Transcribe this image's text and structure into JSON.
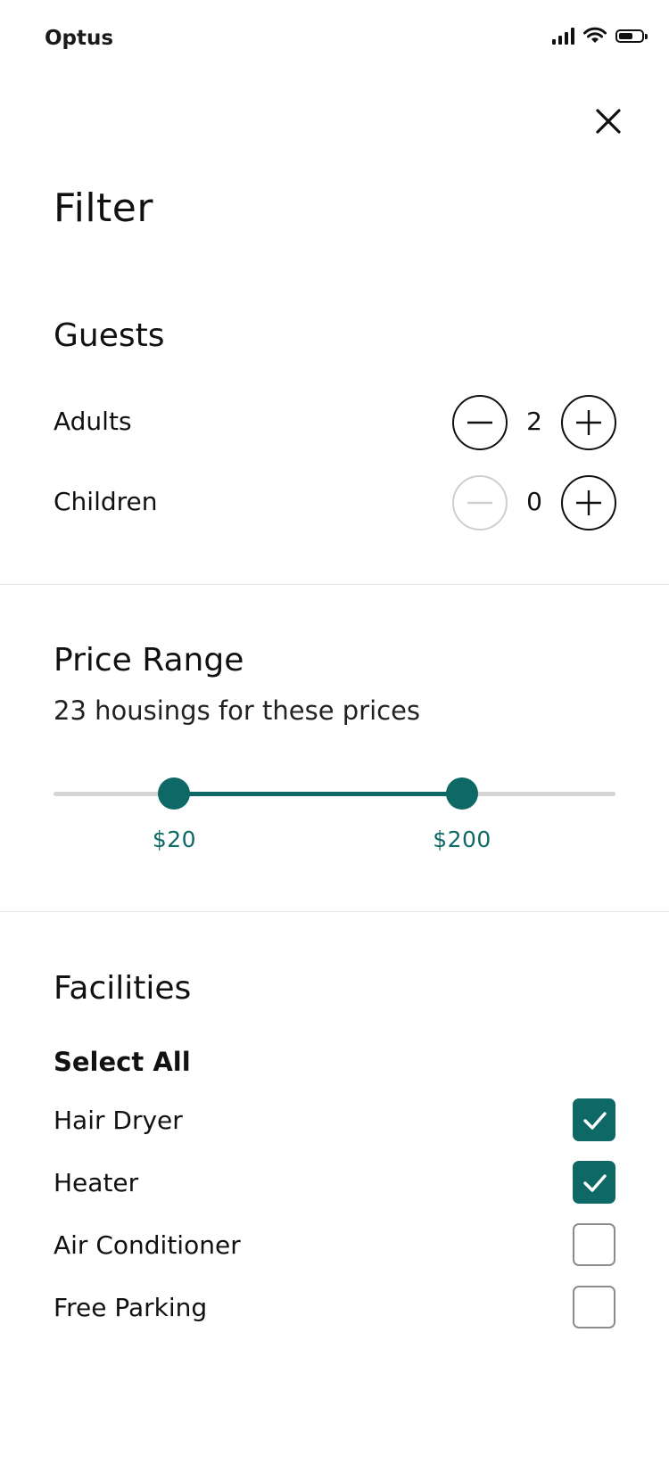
{
  "status_bar": {
    "carrier": "Optus"
  },
  "page": {
    "title": "Filter"
  },
  "guests": {
    "title": "Guests",
    "adults": {
      "label": "Adults",
      "value": "2"
    },
    "children": {
      "label": "Children",
      "value": "0"
    }
  },
  "price_range": {
    "title": "Price Range",
    "subtitle": "23 housings for these prices",
    "min_label": "$20",
    "max_label": "$200",
    "min_fraction": 0.215,
    "max_fraction": 0.727
  },
  "facilities": {
    "title": "Facilities",
    "select_all_label": "Select All",
    "items": [
      {
        "label": "Hair Dryer",
        "checked": true
      },
      {
        "label": "Heater",
        "checked": true
      },
      {
        "label": "Air Conditioner",
        "checked": false
      },
      {
        "label": "Free Parking",
        "checked": false
      }
    ]
  },
  "colors": {
    "accent": "#0e6966",
    "divider": "#e4e4e4",
    "disabled": "#cfcfcf"
  },
  "icons": {
    "close": "close-icon",
    "minus": "minus-icon",
    "plus": "plus-icon",
    "check": "check-icon",
    "signal": "signal-icon",
    "wifi": "wifi-icon",
    "battery": "battery-icon"
  }
}
